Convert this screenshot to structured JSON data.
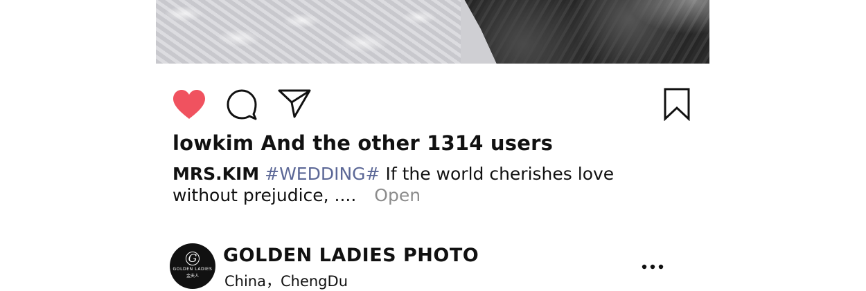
{
  "post": {
    "likes_text": "lowkim And the other 1314 users",
    "caption": {
      "username": "MRS.KIM",
      "hashtag": "#WEDDING#",
      "text": "If the world cherishes love without prejudice, ....",
      "more_label": "Open"
    },
    "icons": {
      "like": "heart-icon",
      "comment": "comment-bubble-icon",
      "share": "paper-plane-icon",
      "save": "bookmark-icon"
    },
    "like_color": "#f0525f"
  },
  "next_post": {
    "account_name": "GOLDEN LADIES PHOTO",
    "location": "China，ChengDu",
    "avatar": {
      "monogram": "G",
      "brand": "GOLDEN LADIES",
      "sub": "金夫人"
    },
    "more_icon": "more-dots-icon"
  }
}
